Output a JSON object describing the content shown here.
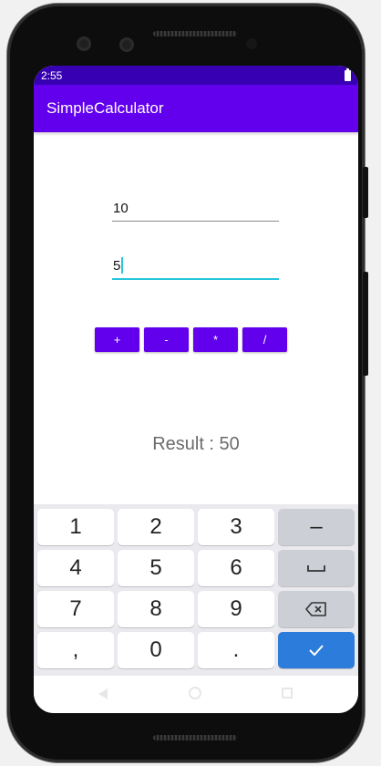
{
  "status": {
    "time": "2:55"
  },
  "app": {
    "title": "SimpleCalculator"
  },
  "inputs": {
    "first_value": "10",
    "second_value": "5"
  },
  "operators": [
    "+",
    "-",
    "*",
    "/"
  ],
  "result": {
    "text": "Result : 50"
  },
  "keyboard": {
    "keys": [
      "1",
      "2",
      "3",
      "–",
      "4",
      "5",
      "6",
      "space",
      "7",
      "8",
      "9",
      "backspace",
      ",",
      "0",
      ".",
      "done"
    ],
    "labels": {
      "k1": "1",
      "k2": "2",
      "k3": "3",
      "minus": "–",
      "k4": "4",
      "k5": "5",
      "k6": "6",
      "k7": "7",
      "k8": "8",
      "k9": "9",
      "comma": ",",
      "k0": "0",
      "period": "."
    },
    "colors": {
      "done": "#2b7cdb",
      "function_key": "#ccd0d6"
    }
  },
  "colors": {
    "primary": "#6200ee",
    "primary_dark": "#3700b3",
    "accent": "#26c6da"
  },
  "icons": [
    "battery-icon",
    "space-icon",
    "backspace-icon",
    "check-icon",
    "nav-back-icon",
    "nav-home-icon",
    "nav-recent-icon"
  ]
}
